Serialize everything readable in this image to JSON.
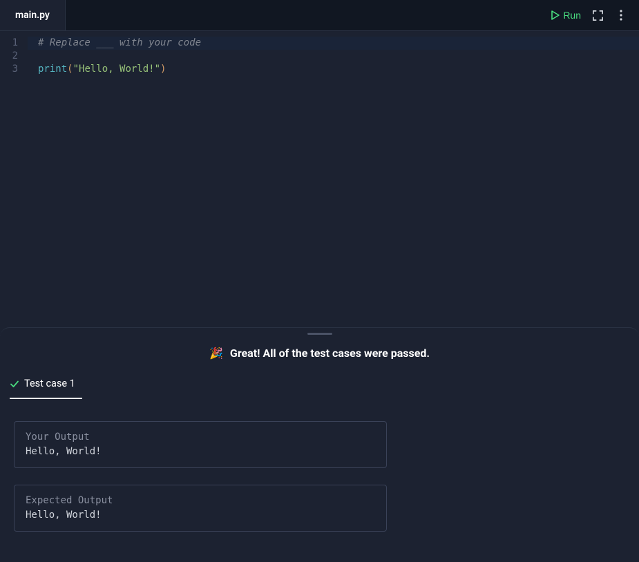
{
  "header": {
    "file_tab": "main.py",
    "run_label": "Run"
  },
  "code": {
    "lines": [
      {
        "n": "1",
        "type": "comment",
        "text": "# Replace ___ with your code",
        "highlighted": true
      },
      {
        "n": "2",
        "type": "blank",
        "text": "",
        "highlighted": false
      },
      {
        "n": "3",
        "type": "print",
        "func": "print",
        "open": "(",
        "str": "\"Hello, World!\"",
        "close": ")",
        "highlighted": false
      }
    ]
  },
  "output": {
    "banner_emoji": "🎉",
    "banner_text": "Great! All of the test cases were passed.",
    "tabs": [
      {
        "label": "Test case 1",
        "passed": true
      }
    ],
    "your_output_label": "Your Output",
    "your_output_value": "Hello, World!",
    "expected_output_label": "Expected Output",
    "expected_output_value": "Hello, World!"
  },
  "colors": {
    "success": "#4ade80",
    "bg": "#1c2231",
    "header_bg": "#111722"
  }
}
